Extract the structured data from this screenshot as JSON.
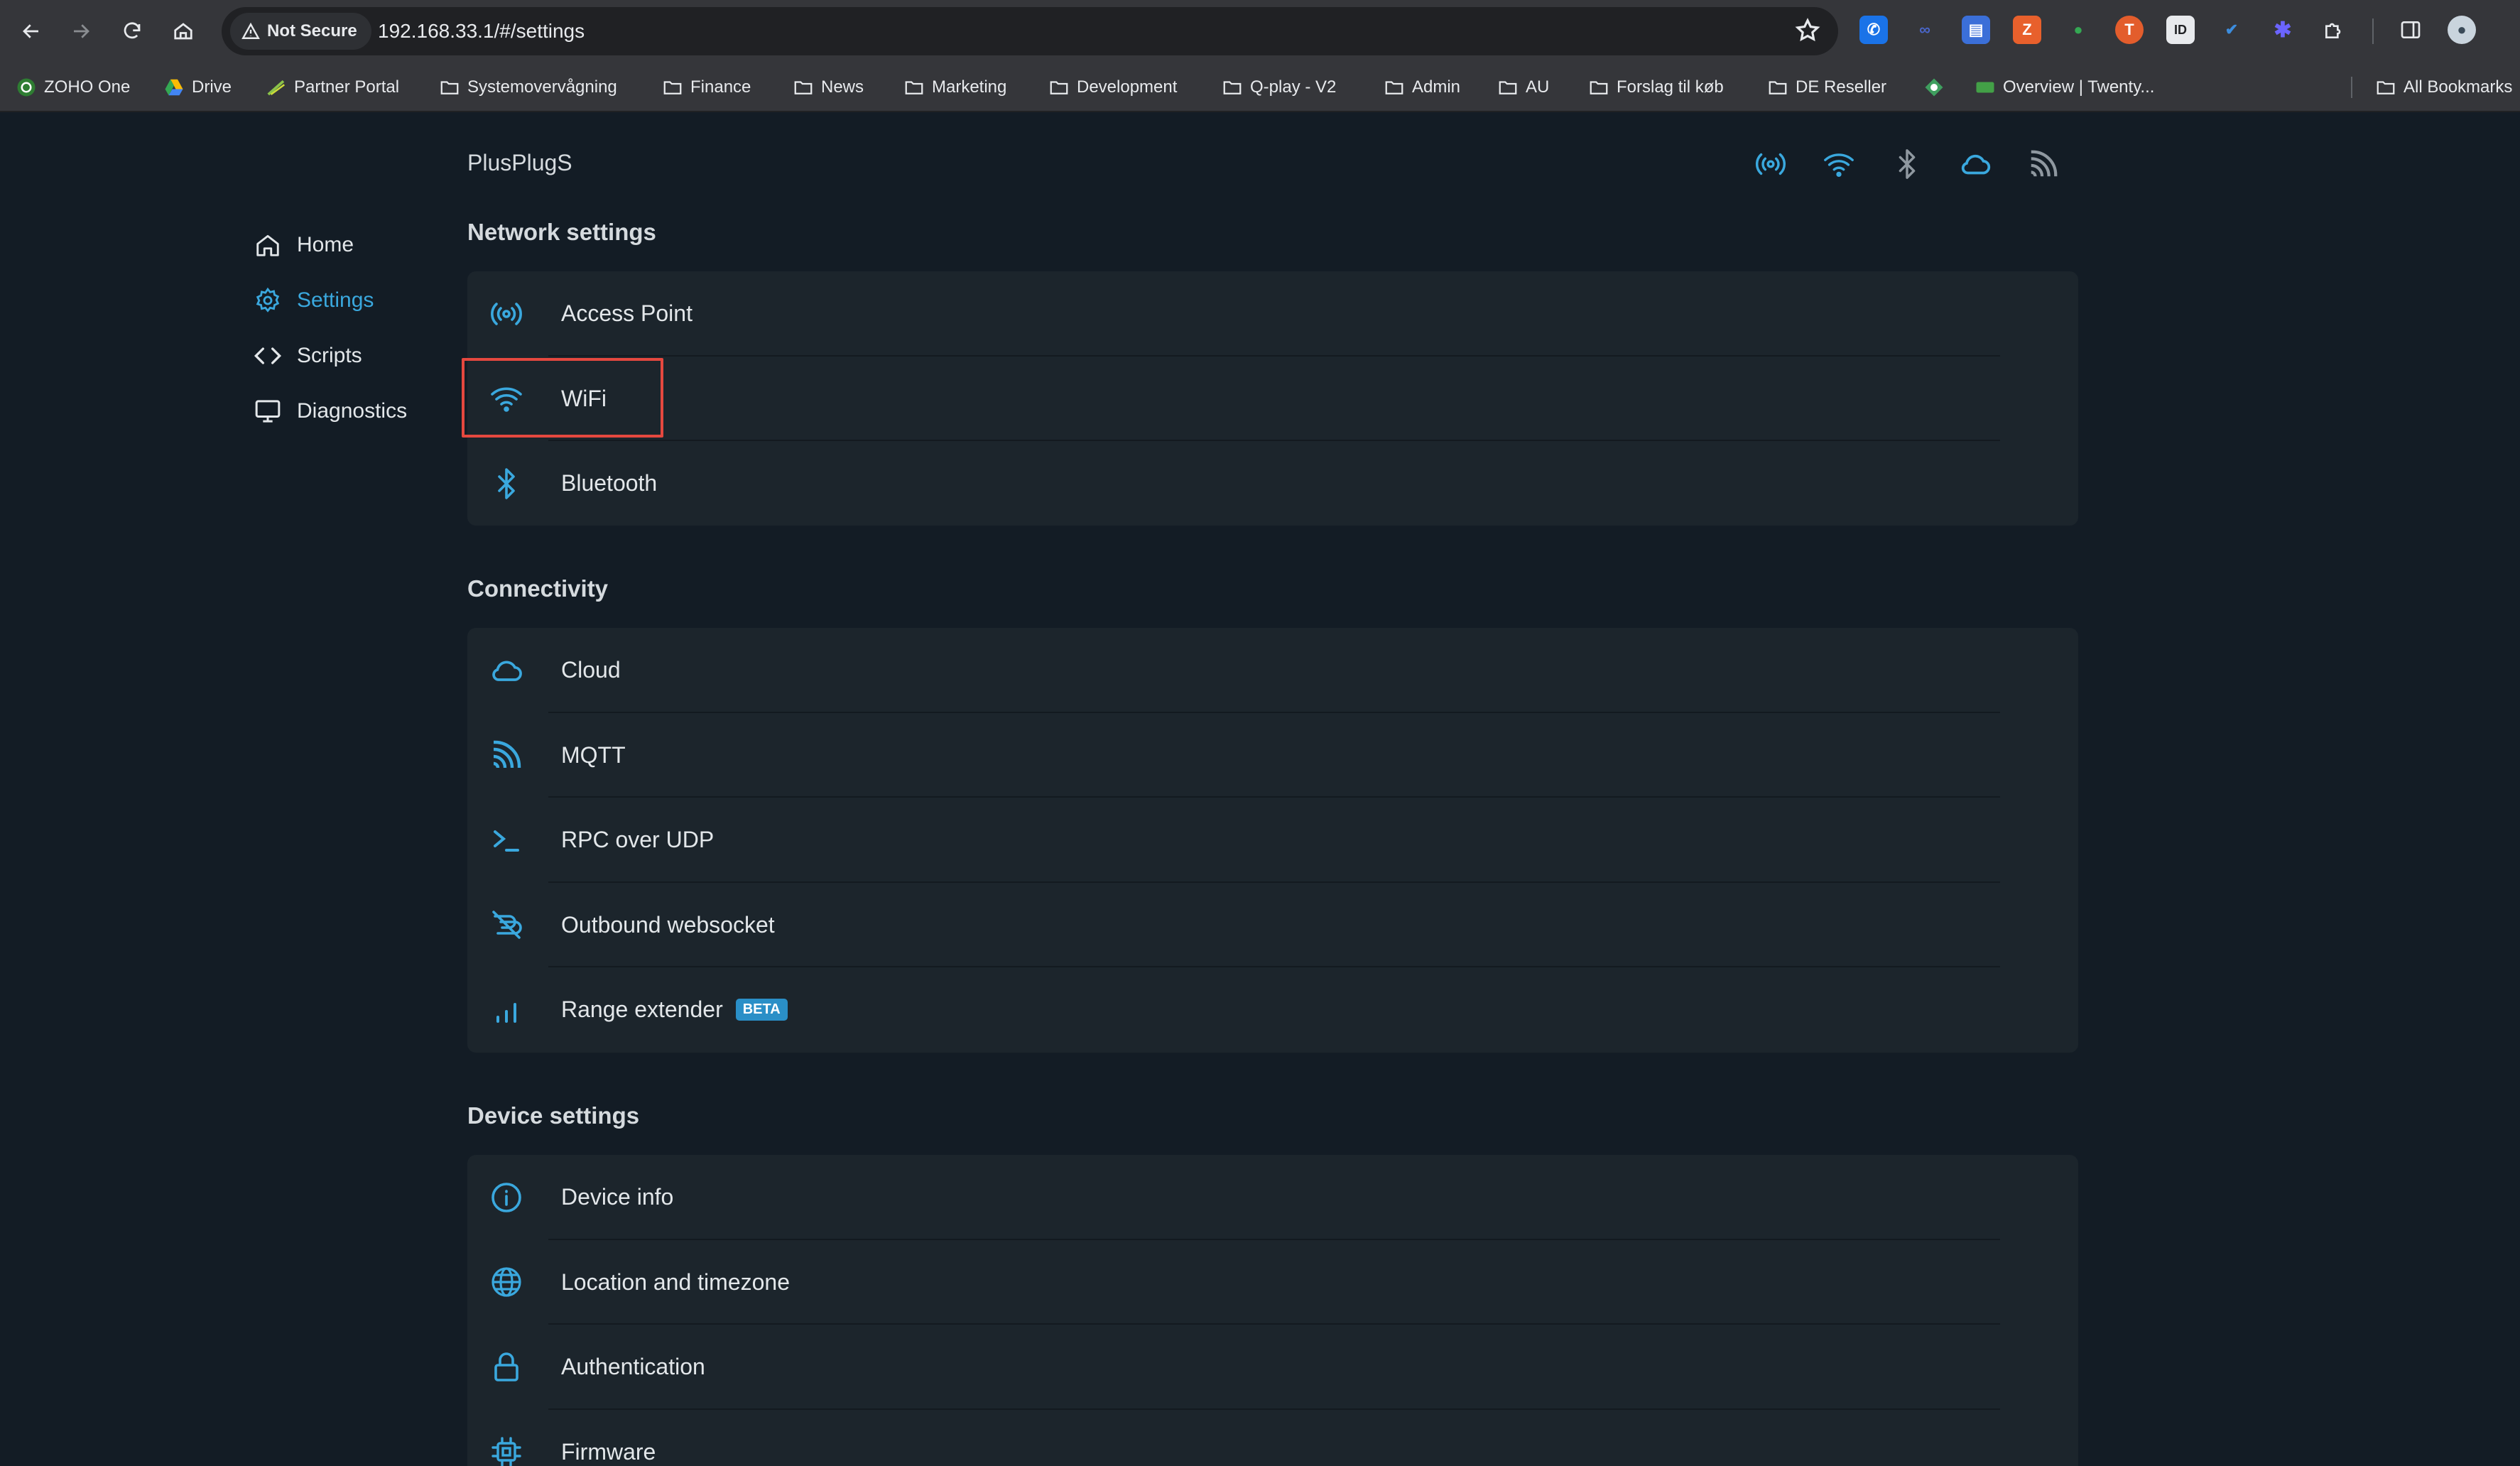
{
  "browser": {
    "security_label": "Not Secure",
    "url": "192.168.33.1/#/settings",
    "bookmarks": [
      {
        "label": "ZOHO One",
        "icon": "zoho-icon"
      },
      {
        "label": "Drive",
        "icon": "drive-icon"
      },
      {
        "label": "Partner Portal",
        "icon": "partner-portal-icon"
      },
      {
        "label": "Systemovervågning",
        "icon": "folder-icon"
      },
      {
        "label": "Finance",
        "icon": "folder-icon"
      },
      {
        "label": "News",
        "icon": "folder-icon"
      },
      {
        "label": "Marketing",
        "icon": "folder-icon"
      },
      {
        "label": "Development",
        "icon": "folder-icon"
      },
      {
        "label": "Q-play - V2",
        "icon": "folder-icon"
      },
      {
        "label": "Admin",
        "icon": "folder-icon"
      },
      {
        "label": "AU",
        "icon": "folder-icon"
      },
      {
        "label": "Forslag til køb",
        "icon": "folder-icon"
      },
      {
        "label": "DE Reseller",
        "icon": "folder-icon"
      },
      {
        "label": "",
        "icon": "diamond-icon"
      },
      {
        "label": "Overview | Twenty...",
        "icon": "overview-icon"
      }
    ],
    "all_bookmarks": "All Bookmarks"
  },
  "app": {
    "device_name": "PlusPlugS",
    "nav": [
      {
        "label": "Home",
        "icon": "home-icon"
      },
      {
        "label": "Settings",
        "icon": "gear-icon",
        "active": true
      },
      {
        "label": "Scripts",
        "icon": "code-icon"
      },
      {
        "label": "Diagnostics",
        "icon": "monitor-icon"
      }
    ],
    "sections": [
      {
        "title": "Network settings",
        "items": [
          {
            "label": "Access Point",
            "icon": "access-point-icon"
          },
          {
            "label": "WiFi",
            "icon": "wifi-icon"
          },
          {
            "label": "Bluetooth",
            "icon": "bluetooth-icon"
          }
        ]
      },
      {
        "title": "Connectivity",
        "items": [
          {
            "label": "Cloud",
            "icon": "cloud-icon"
          },
          {
            "label": "MQTT",
            "icon": "mqtt-icon"
          },
          {
            "label": "RPC over UDP",
            "icon": "terminal-icon"
          },
          {
            "label": "Outbound websocket",
            "icon": "websocket-icon"
          },
          {
            "label": "Range extender",
            "icon": "signal-bars-icon",
            "badge": "BETA"
          }
        ]
      },
      {
        "title": "Device settings",
        "items": [
          {
            "label": "Device info",
            "icon": "info-icon"
          },
          {
            "label": "Location and timezone",
            "icon": "globe-icon"
          },
          {
            "label": "Authentication",
            "icon": "lock-icon"
          },
          {
            "label": "Firmware",
            "icon": "chip-icon"
          }
        ]
      }
    ]
  },
  "colors": {
    "accent": "#3aa8de",
    "background": "#131c25",
    "card": "#1c252c",
    "highlight": "#e5483f",
    "beta_badge": "#2a8fc7"
  }
}
